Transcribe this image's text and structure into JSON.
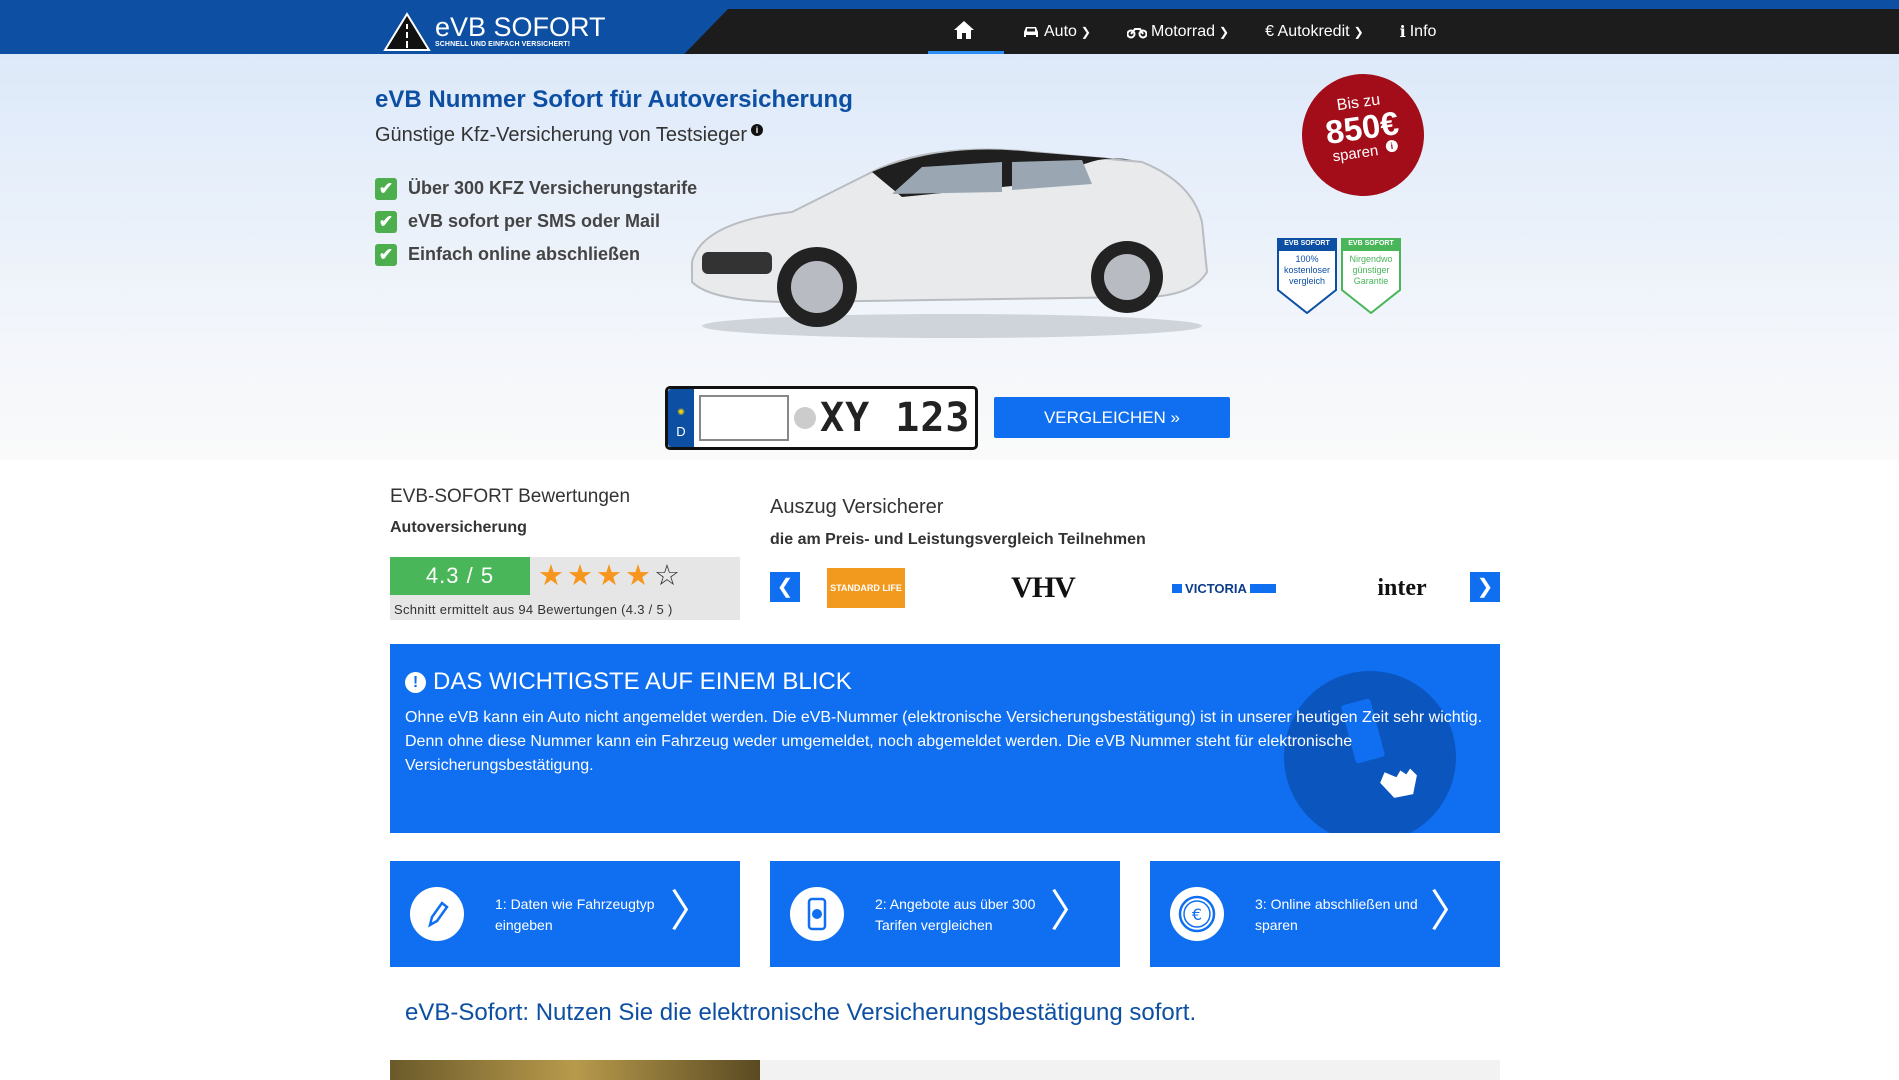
{
  "brand": {
    "name": "eVB SOFORT",
    "tagline": "SCHNELL UND EINFACH VERSICHERT!"
  },
  "nav": {
    "home_icon": "home-icon",
    "items": [
      {
        "label": "Auto",
        "icon": "car-icon"
      },
      {
        "label": "Motorrad",
        "icon": "motorcycle-icon"
      },
      {
        "label": "€ Autokredit",
        "icon": ""
      },
      {
        "label": "Info",
        "icon": "info-icon"
      }
    ]
  },
  "hero": {
    "title_p1": "eVB",
    "title_p2": " Nummer ",
    "title_p3": "Sofort",
    "title_p4": " für Autoversicherung",
    "subtitle": "Günstige Kfz-Versicherung von Testsieger",
    "features": [
      "Über 300 KFZ Versicherungstarife",
      "eVB sofort per SMS oder Mail",
      "Einfach online abschließen"
    ],
    "badge": {
      "line1": "Bis zu",
      "amount": "850€",
      "line3": "sparen"
    },
    "seals": [
      {
        "head": "EVB SOFORT",
        "text": "100% kostenloser vergleich"
      },
      {
        "head": "EVB SOFORT",
        "text": "Nirgendwo günstiger Garantie"
      }
    ]
  },
  "plate": {
    "country": "D",
    "placeholder": "XY 123",
    "input_value": ""
  },
  "compare_button": "VERGLEICHEN »",
  "ratings": {
    "title": "EVB-SOFORT Bewertungen",
    "subtitle": "Autoversicherung",
    "score": "4.3 / 5",
    "stars_filled": 4,
    "stars_total": 5,
    "note": "Schnitt ermittelt aus 94 Bewertungen (4.3 / 5 )"
  },
  "insurers": {
    "title": "Auszug Versicherer",
    "subtitle": "die am Preis- und Leistungsvergleich Teilnehmen",
    "logos": [
      "STANDARD LIFE",
      "VHV",
      "VICTORIA",
      "inter"
    ]
  },
  "info": {
    "heading": "DAS WICHTIGSTE AUF EINEM BLICK",
    "text": "Ohne eVB kann ein Auto nicht angemeldet werden. Die eVB-Nummer (elektronische Versicherungsbestätigung) ist in unserer heutigen Zeit sehr wichtig. Denn ohne diese Nummer kann ein Fahrzeug weder umgemeldet, noch abgemeldet werden. Die eVB Nummer steht für elektronische Versicherungsbestätigung."
  },
  "steps": [
    {
      "text": "1: Daten wie Fahrzeugtyp eingeben",
      "icon": "pencil-icon"
    },
    {
      "text": "2: Angebote aus über 300 Tarifen vergleichen",
      "icon": "smartphone-info-icon"
    },
    {
      "text": "3: Online abschließen und sparen",
      "icon": "euro-icon"
    }
  ],
  "bottom_title": "eVB-Sofort: Nutzen Sie die elektronische Versicherungsbestätigung sofort.",
  "colors": {
    "primary": "#0f6ff0",
    "dark_blue": "#0d4fa3",
    "nav_bg": "#1c1c1c",
    "badge": "#a30d1a",
    "rating_green": "#49b65a",
    "star": "#f6961e"
  }
}
